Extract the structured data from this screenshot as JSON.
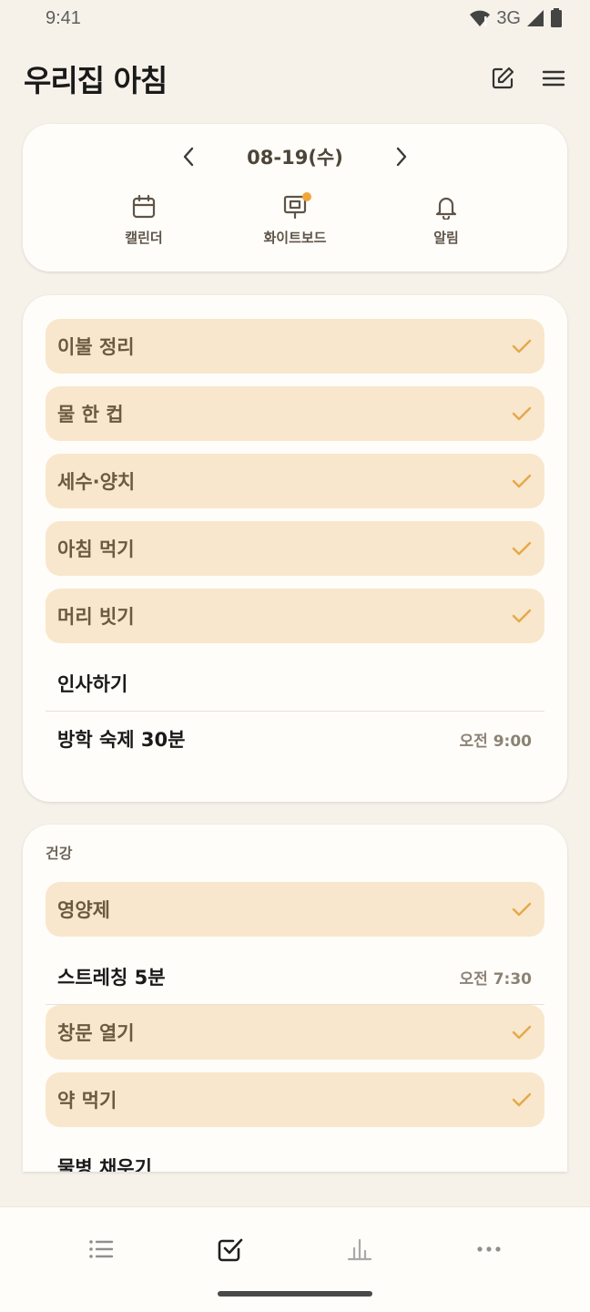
{
  "status_bar": {
    "time": "9:41",
    "network": "3G"
  },
  "header": {
    "title": "우리집 아침",
    "edit_icon": "edit-icon",
    "menu_icon": "menu-icon"
  },
  "date_nav": {
    "date": "08-19(수)",
    "prev_icon": "chevron-left-icon",
    "next_icon": "chevron-right-icon",
    "shortcuts": [
      {
        "label": "캘린더",
        "icon": "calendar-icon",
        "badge": false
      },
      {
        "label": "화이트보드",
        "icon": "whiteboard-icon",
        "badge": true
      },
      {
        "label": "알림",
        "icon": "bell-icon",
        "badge": false
      }
    ]
  },
  "tasks": [
    {
      "label": "이불 정리",
      "done": true,
      "time": ""
    },
    {
      "label": "물 한 컵",
      "done": true,
      "time": ""
    },
    {
      "label": "세수·양치",
      "done": true,
      "time": ""
    },
    {
      "label": "아침 먹기",
      "done": true,
      "time": ""
    },
    {
      "label": "머리 빗기",
      "done": true,
      "time": ""
    },
    {
      "label": "인사하기",
      "done": false,
      "time": ""
    },
    {
      "label": "방학 숙제 30분",
      "done": false,
      "time": "오전 9:00"
    }
  ],
  "health": {
    "title": "건강",
    "tasks": [
      {
        "label": "영양제",
        "done": true,
        "time": ""
      },
      {
        "label": "스트레칭 5분",
        "done": false,
        "time": "오전 7:30"
      },
      {
        "label": "창문 열기",
        "done": true,
        "time": ""
      },
      {
        "label": "약 먹기",
        "done": true,
        "time": ""
      },
      {
        "label": "물병 채우기",
        "done": false,
        "time": ""
      }
    ]
  },
  "bottom_nav": {
    "items": [
      {
        "icon": "list-icon",
        "active": false
      },
      {
        "icon": "checkbox-icon",
        "active": true
      },
      {
        "icon": "bar-chart-icon",
        "active": false
      },
      {
        "icon": "more-icon",
        "active": false
      }
    ]
  },
  "colors": {
    "accent": "#f2a53a",
    "done_bg": "#f8e7cc",
    "check": "#e6a84a",
    "background": "#f6f2ea"
  }
}
